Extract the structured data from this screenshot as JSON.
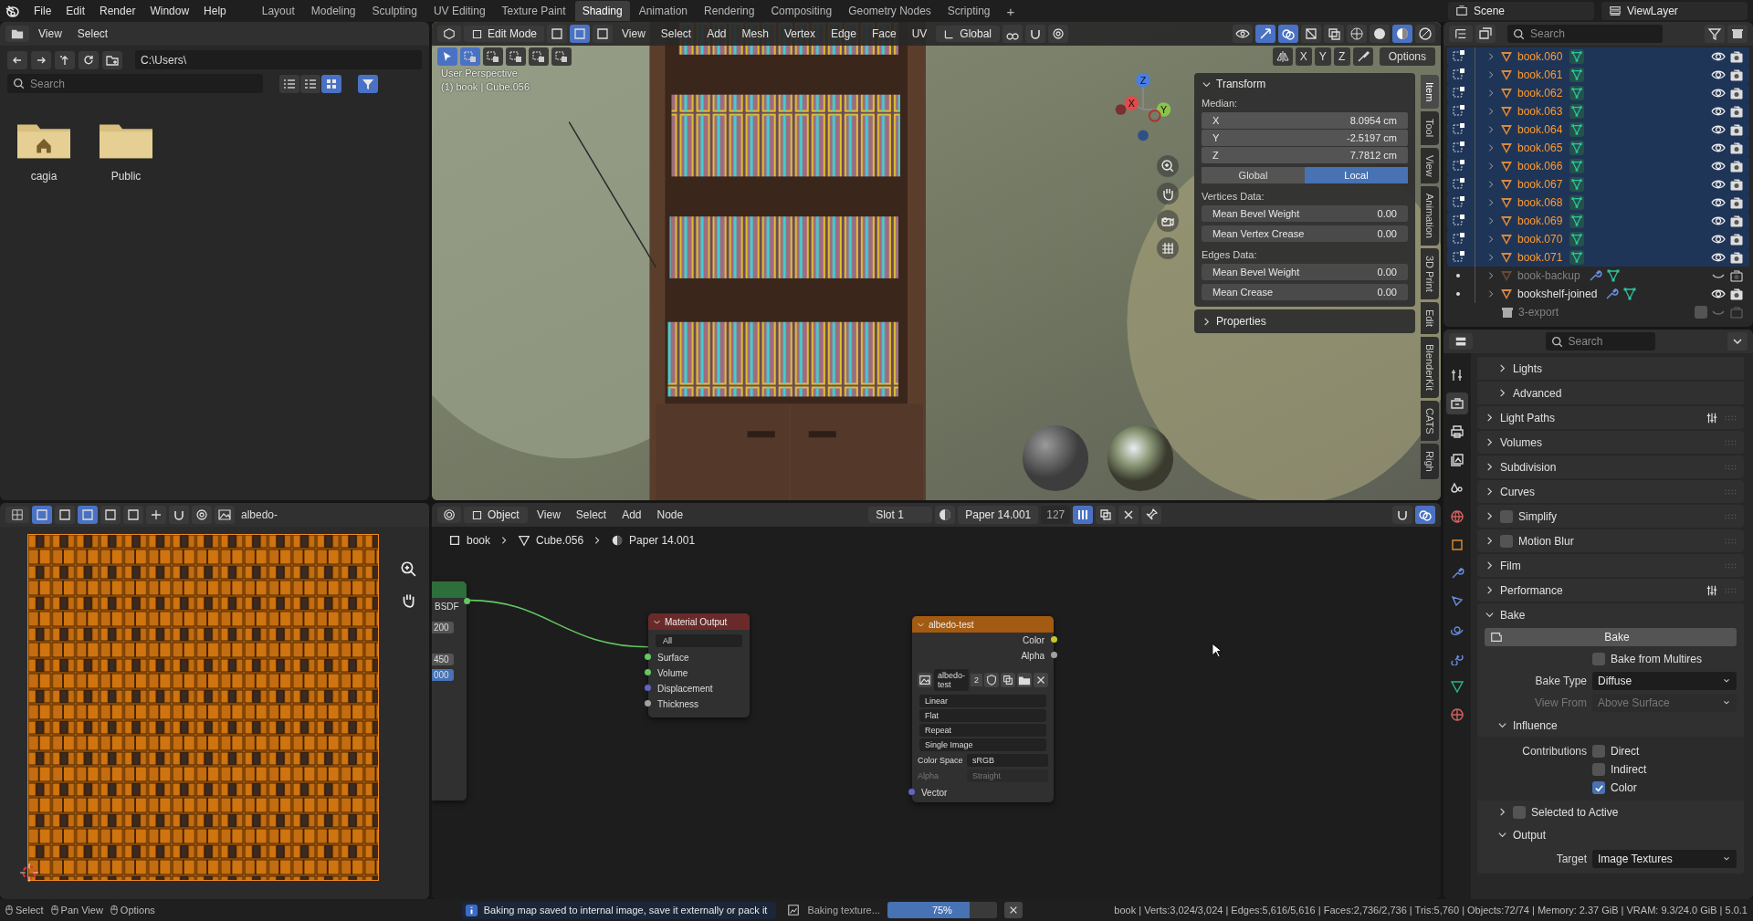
{
  "top_bar": {
    "menus": [
      "File",
      "Edit",
      "Render",
      "Window",
      "Help"
    ],
    "workspaces": [
      {
        "label": "Layout",
        "selected": false
      },
      {
        "label": "Modeling",
        "selected": false
      },
      {
        "label": "Sculpting",
        "selected": false
      },
      {
        "label": "UV Editing",
        "selected": false
      },
      {
        "label": "Texture Paint",
        "selected": false
      },
      {
        "label": "Shading",
        "selected": true
      },
      {
        "label": "Animation",
        "selected": false
      },
      {
        "label": "Rendering",
        "selected": false
      },
      {
        "label": "Compositing",
        "selected": false
      },
      {
        "label": "Geometry Nodes",
        "selected": false
      },
      {
        "label": "Scripting",
        "selected": false
      }
    ],
    "add_workspace": "+",
    "scene": "Scene",
    "view_layer": "ViewLayer"
  },
  "file_browser": {
    "menus": [
      "View",
      "Select"
    ],
    "path": "C:\\Users\\",
    "search_placeholder": "Search",
    "items": [
      {
        "name": "cagia",
        "kind": "home"
      },
      {
        "name": "Public",
        "kind": "folder"
      }
    ]
  },
  "viewport": {
    "mode": "Edit Mode",
    "menus": [
      "View",
      "Select",
      "Add",
      "Mesh",
      "Vertex",
      "Edge",
      "Face",
      "UV"
    ],
    "orientation": "Global",
    "axis_buttons": [
      "X",
      "Y",
      "Z"
    ],
    "options": "Options",
    "info": [
      "User Perspective",
      "(1) book | Cube.056"
    ],
    "gizmo": [
      "X",
      "Y",
      "Z"
    ],
    "transform": {
      "title": "Transform",
      "expanded": true,
      "median_label": "Median:",
      "coords": [
        {
          "axis": "X",
          "value": "8.0954 cm"
        },
        {
          "axis": "Y",
          "value": "-2.5197 cm"
        },
        {
          "axis": "Z",
          "value": "7.7812 cm"
        }
      ],
      "spaces": [
        {
          "label": "Global",
          "selected": false
        },
        {
          "label": "Local",
          "selected": true
        }
      ],
      "sections": [
        {
          "title": "Vertices Data:",
          "fields": [
            {
              "label": "Mean Bevel Weight",
              "value": "0.00"
            },
            {
              "label": "Mean Vertex Crease",
              "value": "0.00"
            }
          ]
        },
        {
          "title": "Edges Data:",
          "fields": [
            {
              "label": "Mean Bevel Weight",
              "value": "0.00"
            },
            {
              "label": "Mean Crease",
              "value": "0.00"
            }
          ]
        }
      ]
    },
    "properties_panel": {
      "title": "Properties",
      "expanded": false
    },
    "tabs": [
      {
        "label": "Item",
        "selected": true
      },
      {
        "label": "Tool",
        "selected": false
      },
      {
        "label": "View",
        "selected": false
      },
      {
        "label": "Animation",
        "selected": false
      },
      {
        "label": "3D Print",
        "selected": false
      },
      {
        "label": "Edit",
        "selected": false
      },
      {
        "label": "BlenderKit",
        "selected": false
      },
      {
        "label": "CATS",
        "selected": false
      },
      {
        "label": "Righ",
        "selected": false
      }
    ]
  },
  "uv_editor": {
    "image": "albedo-"
  },
  "node_editor": {
    "mode": "Object",
    "menus": [
      "View",
      "Select",
      "Add",
      "Node"
    ],
    "slot": "Slot 1",
    "material": "Paper 14.001",
    "users": "127",
    "breadcrumbs": [
      "book",
      "Cube.056",
      "Paper 14.001"
    ],
    "bsdf_node": {
      "label": "BSDF",
      "values": [
        {
          "text": "200",
          "selected": false
        },
        {
          "text": "450",
          "selected": false
        },
        {
          "text": "000",
          "selected": true
        }
      ]
    },
    "output_node": {
      "title": "Material Output",
      "target": "All",
      "inputs": [
        {
          "label": "Surface",
          "color": "#63c763"
        },
        {
          "label": "Volume",
          "color": "#63c763"
        },
        {
          "label": "Displacement",
          "color": "#6363c7"
        },
        {
          "label": "Thickness",
          "color": "#a1a1a1"
        }
      ]
    },
    "image_node": {
      "title": "albedo-test",
      "outputs": [
        {
          "label": "Color",
          "color": "#c7c729"
        },
        {
          "label": "Alpha",
          "color": "#a1a1a1"
        }
      ],
      "image": "albedo-test",
      "users": "2",
      "dropdowns": [
        "Linear",
        "Flat",
        "Repeat",
        "Single Image"
      ],
      "settings": [
        {
          "label": "Color Space",
          "value": "sRGB",
          "disabled": false
        },
        {
          "label": "Alpha",
          "value": "Straight",
          "disabled": true
        }
      ],
      "input": {
        "label": "Vector",
        "color": "#6363c7"
      }
    }
  },
  "outliner": {
    "search_placeholder": "Search",
    "items": [
      {
        "name": "book.060",
        "kind": "object",
        "selected": true,
        "visible": true,
        "disabled": false,
        "modifier": false
      },
      {
        "name": "book.061",
        "kind": "object",
        "selected": true,
        "visible": true,
        "disabled": false,
        "modifier": false
      },
      {
        "name": "book.062",
        "kind": "object",
        "selected": true,
        "visible": true,
        "disabled": false,
        "modifier": false
      },
      {
        "name": "book.063",
        "kind": "object",
        "selected": true,
        "visible": true,
        "disabled": false,
        "modifier": false
      },
      {
        "name": "book.064",
        "kind": "object",
        "selected": true,
        "visible": true,
        "disabled": false,
        "modifier": false
      },
      {
        "name": "book.065",
        "kind": "object",
        "selected": true,
        "visible": true,
        "disabled": false,
        "modifier": false
      },
      {
        "name": "book.066",
        "kind": "object",
        "selected": true,
        "visible": true,
        "disabled": false,
        "modifier": false
      },
      {
        "name": "book.067",
        "kind": "object",
        "selected": true,
        "visible": true,
        "disabled": false,
        "modifier": false
      },
      {
        "name": "book.068",
        "kind": "object",
        "selected": true,
        "visible": true,
        "disabled": false,
        "modifier": false
      },
      {
        "name": "book.069",
        "kind": "object",
        "selected": true,
        "visible": true,
        "disabled": false,
        "modifier": false
      },
      {
        "name": "book.070",
        "kind": "object",
        "selected": true,
        "visible": true,
        "disabled": false,
        "modifier": false
      },
      {
        "name": "book.071",
        "kind": "object",
        "selected": true,
        "visible": true,
        "disabled": false,
        "modifier": false
      },
      {
        "name": "book-backup",
        "kind": "object",
        "selected": false,
        "visible": false,
        "disabled": true,
        "modifier": true
      },
      {
        "name": "bookshelf-joined",
        "kind": "object",
        "selected": false,
        "visible": true,
        "disabled": false,
        "modifier": true
      },
      {
        "name": "3-export",
        "kind": "collection",
        "checked": false
      }
    ]
  },
  "properties": {
    "search_placeholder": "Search",
    "tabs": [
      {
        "kind": "tool",
        "selected": false
      },
      {
        "kind": "render",
        "selected": true
      },
      {
        "kind": "output",
        "selected": false
      },
      {
        "kind": "view_layer",
        "selected": false
      },
      {
        "kind": "scene",
        "selected": false
      },
      {
        "kind": "world",
        "selected": false
      },
      {
        "kind": "object",
        "selected": false
      },
      {
        "kind": "modifiers",
        "selected": false
      },
      {
        "kind": "particles",
        "selected": false
      },
      {
        "kind": "physics",
        "selected": false
      },
      {
        "kind": "constraints",
        "selected": false
      },
      {
        "kind": "data",
        "selected": false
      },
      {
        "kind": "material",
        "selected": false
      }
    ],
    "panels": [
      {
        "label": "Lights",
        "kind": "sub",
        "expanded": false
      },
      {
        "label": "Advanced",
        "kind": "sub",
        "expanded": false
      },
      {
        "label": "Light Paths",
        "kind": "panel",
        "expanded": false,
        "presets": true
      },
      {
        "label": "Volumes",
        "kind": "panel",
        "expanded": false
      },
      {
        "label": "Subdivision",
        "kind": "panel",
        "expanded": false
      },
      {
        "label": "Curves",
        "kind": "panel",
        "expanded": false
      },
      {
        "label": "Simplify",
        "kind": "toggle",
        "expanded": false,
        "checked": false
      },
      {
        "label": "Motion Blur",
        "kind": "toggle",
        "expanded": false,
        "checked": false
      },
      {
        "label": "Film",
        "kind": "panel",
        "expanded": false
      },
      {
        "label": "Performance",
        "kind": "panel",
        "expanded": false,
        "presets": true
      }
    ],
    "bake": {
      "label": "Bake",
      "expanded": true,
      "button": "Bake",
      "multires": {
        "label": "Bake from Multires",
        "checked": false
      },
      "fields": [
        {
          "label": "Bake Type",
          "value": "Diffuse",
          "disabled": false
        },
        {
          "label": "View From",
          "value": "Above Surface",
          "disabled": true
        }
      ],
      "influence": {
        "label": "Influence",
        "expanded": true,
        "contributions_label": "Contributions",
        "options": [
          {
            "label": "Direct",
            "checked": false
          },
          {
            "label": "Indirect",
            "checked": false
          },
          {
            "label": "Color",
            "checked": true
          }
        ]
      },
      "selected_to_active": {
        "label": "Selected to Active",
        "expanded": false,
        "checked": false
      },
      "output": {
        "label": "Output",
        "expanded": true,
        "target_label": "Target",
        "target": "Image Textures"
      }
    }
  },
  "status_bar": {
    "hints": [
      "Select",
      "Pan View",
      "Options"
    ],
    "report": "Baking map saved to internal image, save it externally or pack it",
    "job": "Baking texture...",
    "progress": {
      "level": 0.75,
      "text": "75%"
    },
    "stats": "book | Verts:3,024/3,024 | Edges:5,616/5,616 | Faces:2,736/2,736 | Tris:5,760 | Objects:72/74 | Memory: 2.37 GiB | VRAM: 9.3/24.0 GiB | 5.0.1"
  }
}
